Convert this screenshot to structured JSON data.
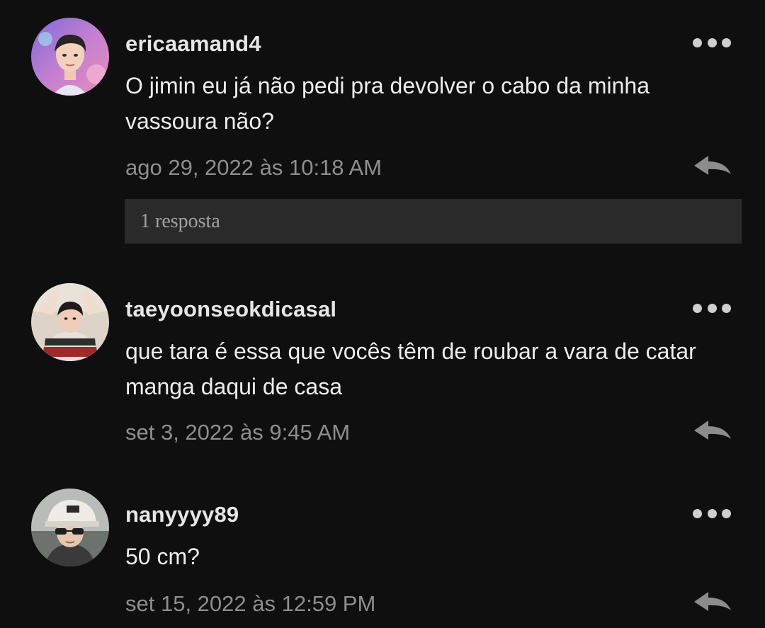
{
  "comments": [
    {
      "username": "ericaamand4",
      "text": "O jimin eu já não pedi pra devolver o cabo da minha vassoura não?",
      "timestamp": "ago 29, 2022 às 10:18 AM",
      "replies_label": "1 resposta"
    },
    {
      "username": "taeyoonseokdicasal",
      "text": "que tara é essa que vocês têm de roubar a vara de catar manga daqui de casa",
      "timestamp": "set 3, 2022 às 9:45 AM"
    },
    {
      "username": "nanyyyy89",
      "text": "50 cm?",
      "timestamp": "set 15, 2022 às 12:59 PM"
    }
  ],
  "icons": {
    "more": "more-dots-icon",
    "reply": "reply-arrow-icon"
  },
  "colors": {
    "background": "#0f0f0f",
    "replies_bar": "#2a2a2a",
    "timestamp": "#8e8e8e",
    "text": "#ececec"
  }
}
